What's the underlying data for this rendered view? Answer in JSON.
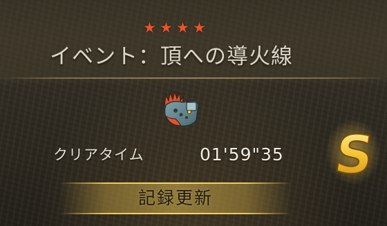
{
  "quest": {
    "stars": [
      "★",
      "★",
      "★",
      "★"
    ],
    "title": "イベント：頂への導火線"
  },
  "monster": {
    "icon": "monster-icon"
  },
  "result": {
    "clear_time_label": "クリアタイム",
    "clear_time_value": "01'59\"35",
    "rank": "S",
    "record_label": "記録更新"
  },
  "colors": {
    "star": "#e8552a",
    "title_text": "#dcd6c6",
    "rank_gold": "#f2c434",
    "banner_gold": "#e8c060"
  }
}
